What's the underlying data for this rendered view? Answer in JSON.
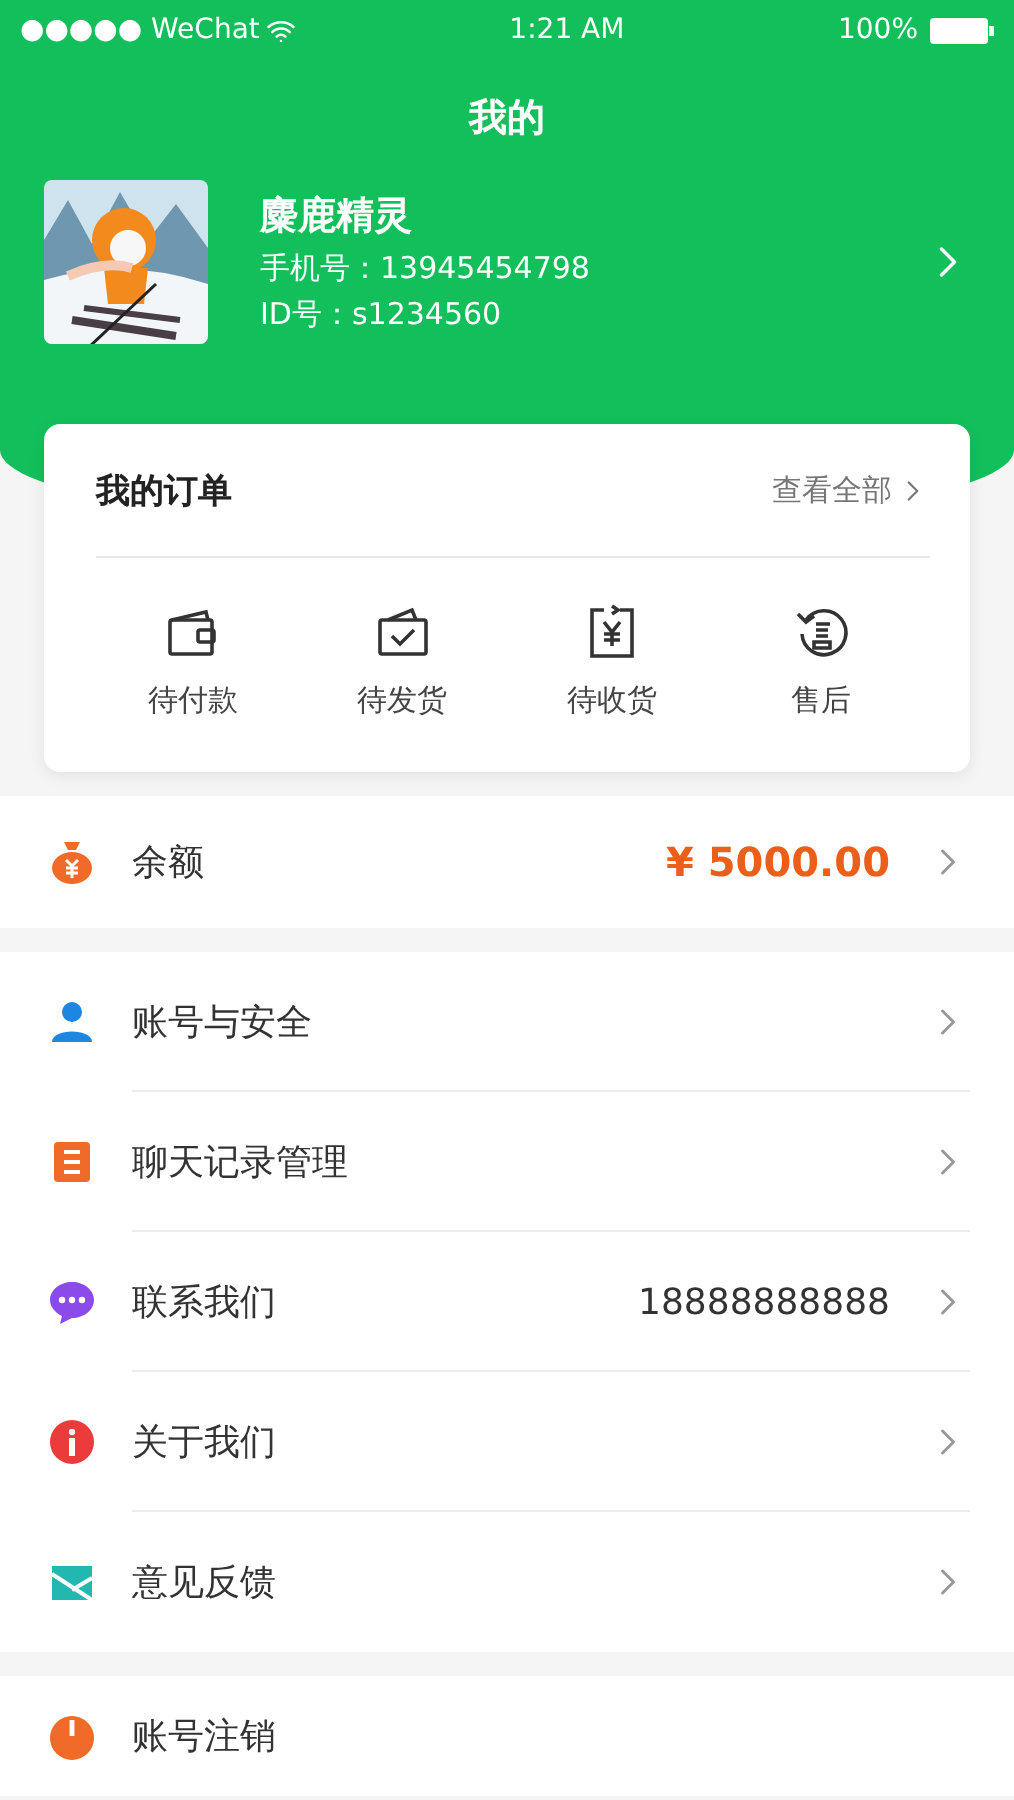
{
  "status_bar": {
    "carrier": "●●●●● WeChat",
    "time": "1:21 AM",
    "battery": "100%"
  },
  "title": "我的",
  "profile": {
    "name": "麋鹿精灵",
    "phone": "手机号：13945454798",
    "id": "ID号：s1234560"
  },
  "orders": {
    "title": "我的订单",
    "view_all": "查看全部",
    "items": [
      {
        "label": "待付款"
      },
      {
        "label": "待发货"
      },
      {
        "label": "待收货"
      },
      {
        "label": "售后"
      }
    ]
  },
  "balance": {
    "label": "余额",
    "value": "¥ 5000.00"
  },
  "menu": [
    {
      "label": "账号与安全"
    },
    {
      "label": "聊天记录管理"
    },
    {
      "label": "联系我们",
      "value": "18888888888"
    },
    {
      "label": "关于我们"
    },
    {
      "label": "意见反馈"
    }
  ],
  "logout": {
    "label": "账号注销"
  }
}
